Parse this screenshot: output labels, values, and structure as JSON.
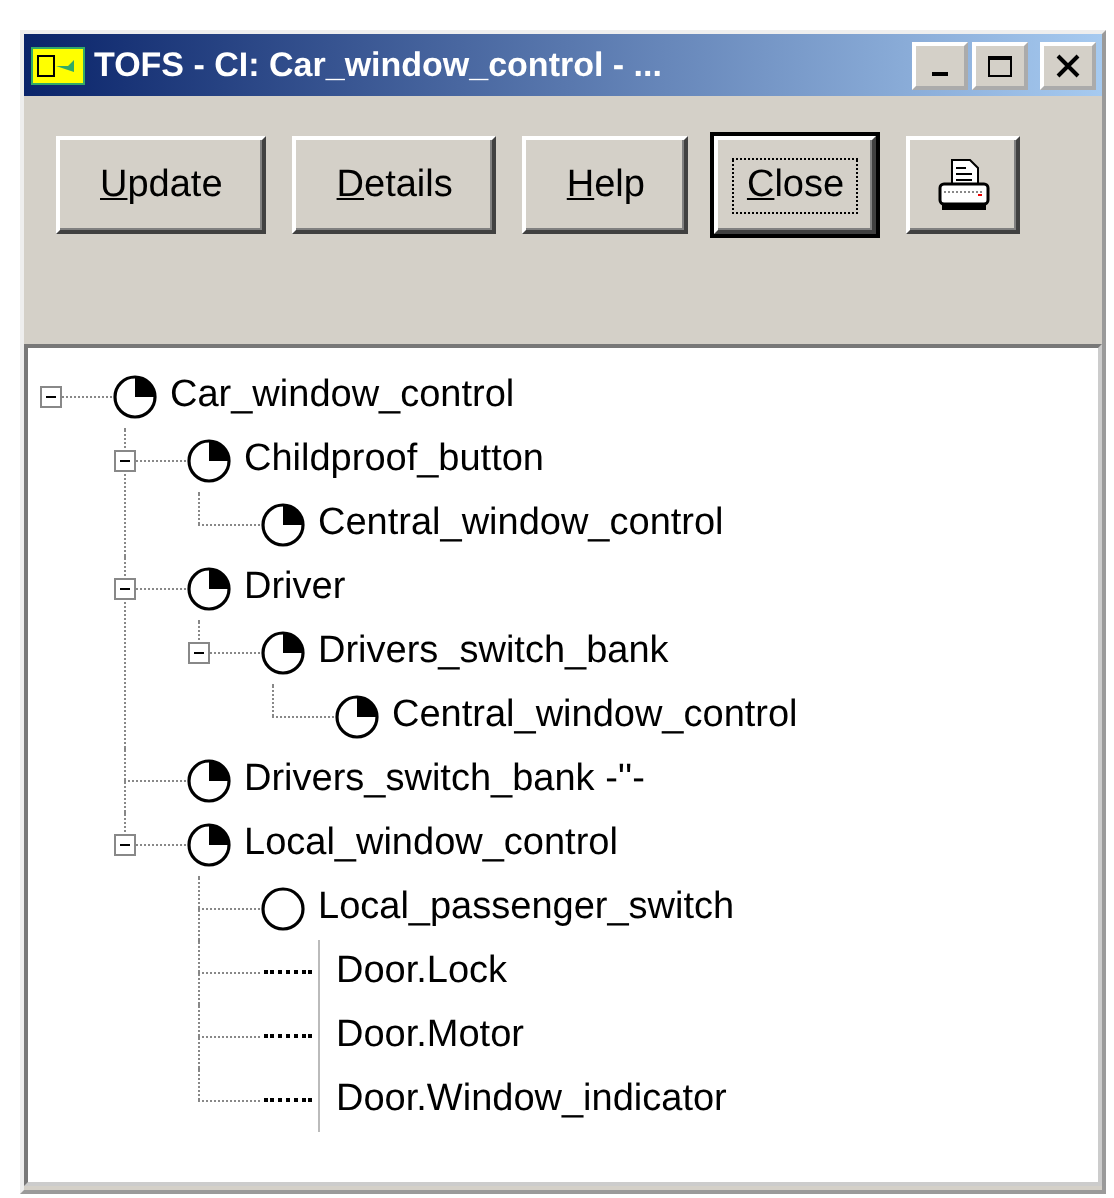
{
  "window": {
    "title": "TOFS - CI: Car_window_control - ..."
  },
  "toolbar": {
    "buttons": [
      {
        "label": "Update",
        "default": false
      },
      {
        "label": "Details",
        "default": false
      },
      {
        "label": "Help",
        "default": false
      },
      {
        "label": "Close",
        "default": true
      },
      {
        "kind": "print",
        "default": false
      }
    ]
  },
  "tree": [
    {
      "label": "Car_window_control",
      "kind": "partial",
      "expanded": true,
      "children": [
        {
          "label": "Childproof_button",
          "kind": "partial",
          "expanded": true,
          "children": [
            {
              "label": "Central_window_control",
              "kind": "partial"
            }
          ]
        },
        {
          "label": "Driver",
          "kind": "partial",
          "expanded": true,
          "children": [
            {
              "label": "Drivers_switch_bank",
              "kind": "partial",
              "expanded": true,
              "children": [
                {
                  "label": "Central_window_control",
                  "kind": "partial"
                }
              ]
            }
          ]
        },
        {
          "label": "Drivers_switch_bank -''-",
          "kind": "partial"
        },
        {
          "label": "Local_window_control",
          "kind": "partial",
          "expanded": true,
          "children": [
            {
              "label": "Local_passenger_switch",
              "kind": "empty"
            },
            {
              "label": "Door.Lock",
              "kind": "signal"
            },
            {
              "label": "Door.Motor",
              "kind": "signal"
            },
            {
              "label": "Door.Window_indicator",
              "kind": "signal"
            }
          ]
        }
      ]
    }
  ]
}
